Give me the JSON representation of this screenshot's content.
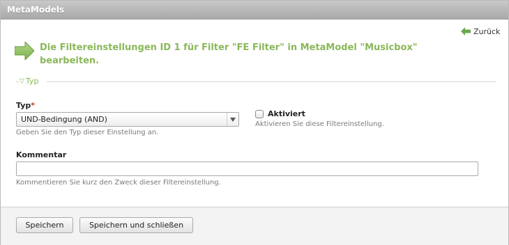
{
  "window": {
    "title": "MetaModels"
  },
  "nav": {
    "back_label": "Zurück",
    "back_icon": "arrow-left-icon"
  },
  "headline": {
    "text": "Die Filtereinstellungen ID 1 für Filter \"FE Filter\" in MetaModel \"Musicbox\" bearbeiten.",
    "icon": "arrow-right-icon",
    "color": "#8ab858"
  },
  "legend": {
    "label": "Typ",
    "toggle_icon": "triangle-down-icon"
  },
  "fields": {
    "type": {
      "label": "Typ",
      "required_marker": "*",
      "selected": "UND-Bedingung (AND)",
      "help": "Geben Sie den Typ dieser Einstellung an."
    },
    "enabled": {
      "label": "Aktiviert",
      "checked": false,
      "help": "Aktivieren Sie diese Filtereinstellung."
    },
    "comment": {
      "label": "Kommentar",
      "value": "",
      "help": "Kommentieren Sie kurz den Zweck dieser Filtereinstellung."
    }
  },
  "footer": {
    "save_label": "Speichern",
    "save_close_label": "Speichern und schließen"
  }
}
